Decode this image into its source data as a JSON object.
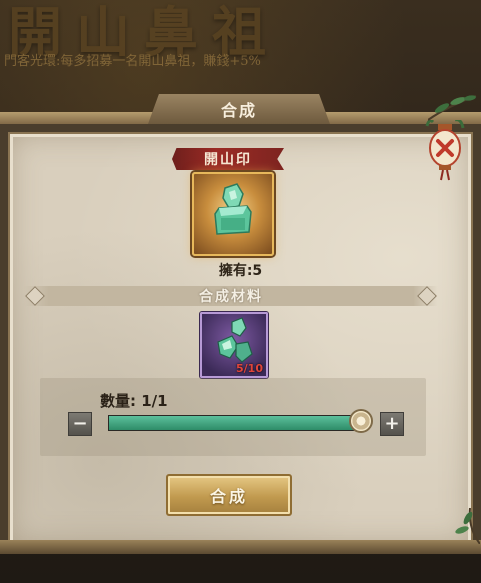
{
  "background": {
    "title": "開山鼻祖",
    "subtitle": "門客光環:每多招募一名開山鼻祖，賺錢+5%"
  },
  "dialog": {
    "title": "合成",
    "item": {
      "name": "開山印",
      "owned_label": "擁有:5",
      "icon": "jade-seal-icon"
    },
    "materials": {
      "header": "合成材料",
      "item_icon": "jade-shard-icon",
      "count": "5/10"
    },
    "quantity": {
      "label": "數量: 1/1",
      "value": 1,
      "max": 1,
      "fraction": 1.0
    },
    "buttons": {
      "minus": "−",
      "plus": "+",
      "synthesize": "合成"
    },
    "close_icon": "lantern-close-icon"
  },
  "colors": {
    "panel": "#d9cfbd",
    "accent_gold": "#c19a4f",
    "slider_fill": "#3da57d",
    "banner_red": "#9b2b25",
    "material_purple": "#5b3f80"
  }
}
